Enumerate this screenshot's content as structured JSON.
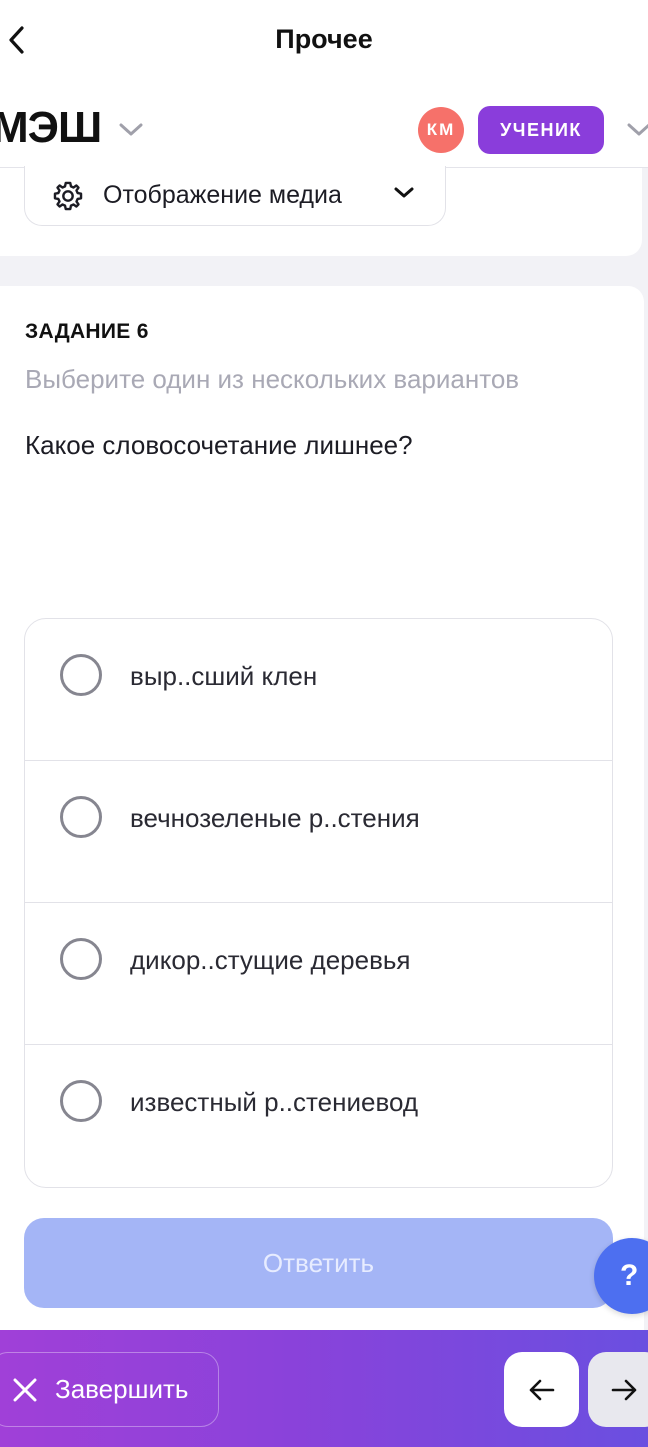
{
  "header": {
    "title": "Прочее"
  },
  "brand": {
    "logo": "МЭШ",
    "avatar_initials": "КМ",
    "role": "УЧЕНИК"
  },
  "media": {
    "label": "Отображение медиа"
  },
  "task": {
    "number": "ЗАДАНИЕ 6",
    "hint": "Выберите один из нескольких вариантов",
    "question": "Какое словосочетание лишнее?",
    "options": [
      {
        "label": "выр..сший клен",
        "selected": false
      },
      {
        "label": "вечнозеленые р..стения",
        "selected": false
      },
      {
        "label": "дикор..стущие деревья",
        "selected": false
      },
      {
        "label": "известный р..стениевод",
        "selected": false
      }
    ],
    "answer_label": "Ответить",
    "answer_enabled": false
  },
  "help": {
    "label": "?"
  },
  "footer": {
    "finish_label": "Завершить"
  },
  "colors": {
    "accent_purple": "#8a3ddb",
    "avatar": "#f6716a",
    "answer_disabled": "#a4b5f6",
    "help": "#4d6ff0"
  }
}
